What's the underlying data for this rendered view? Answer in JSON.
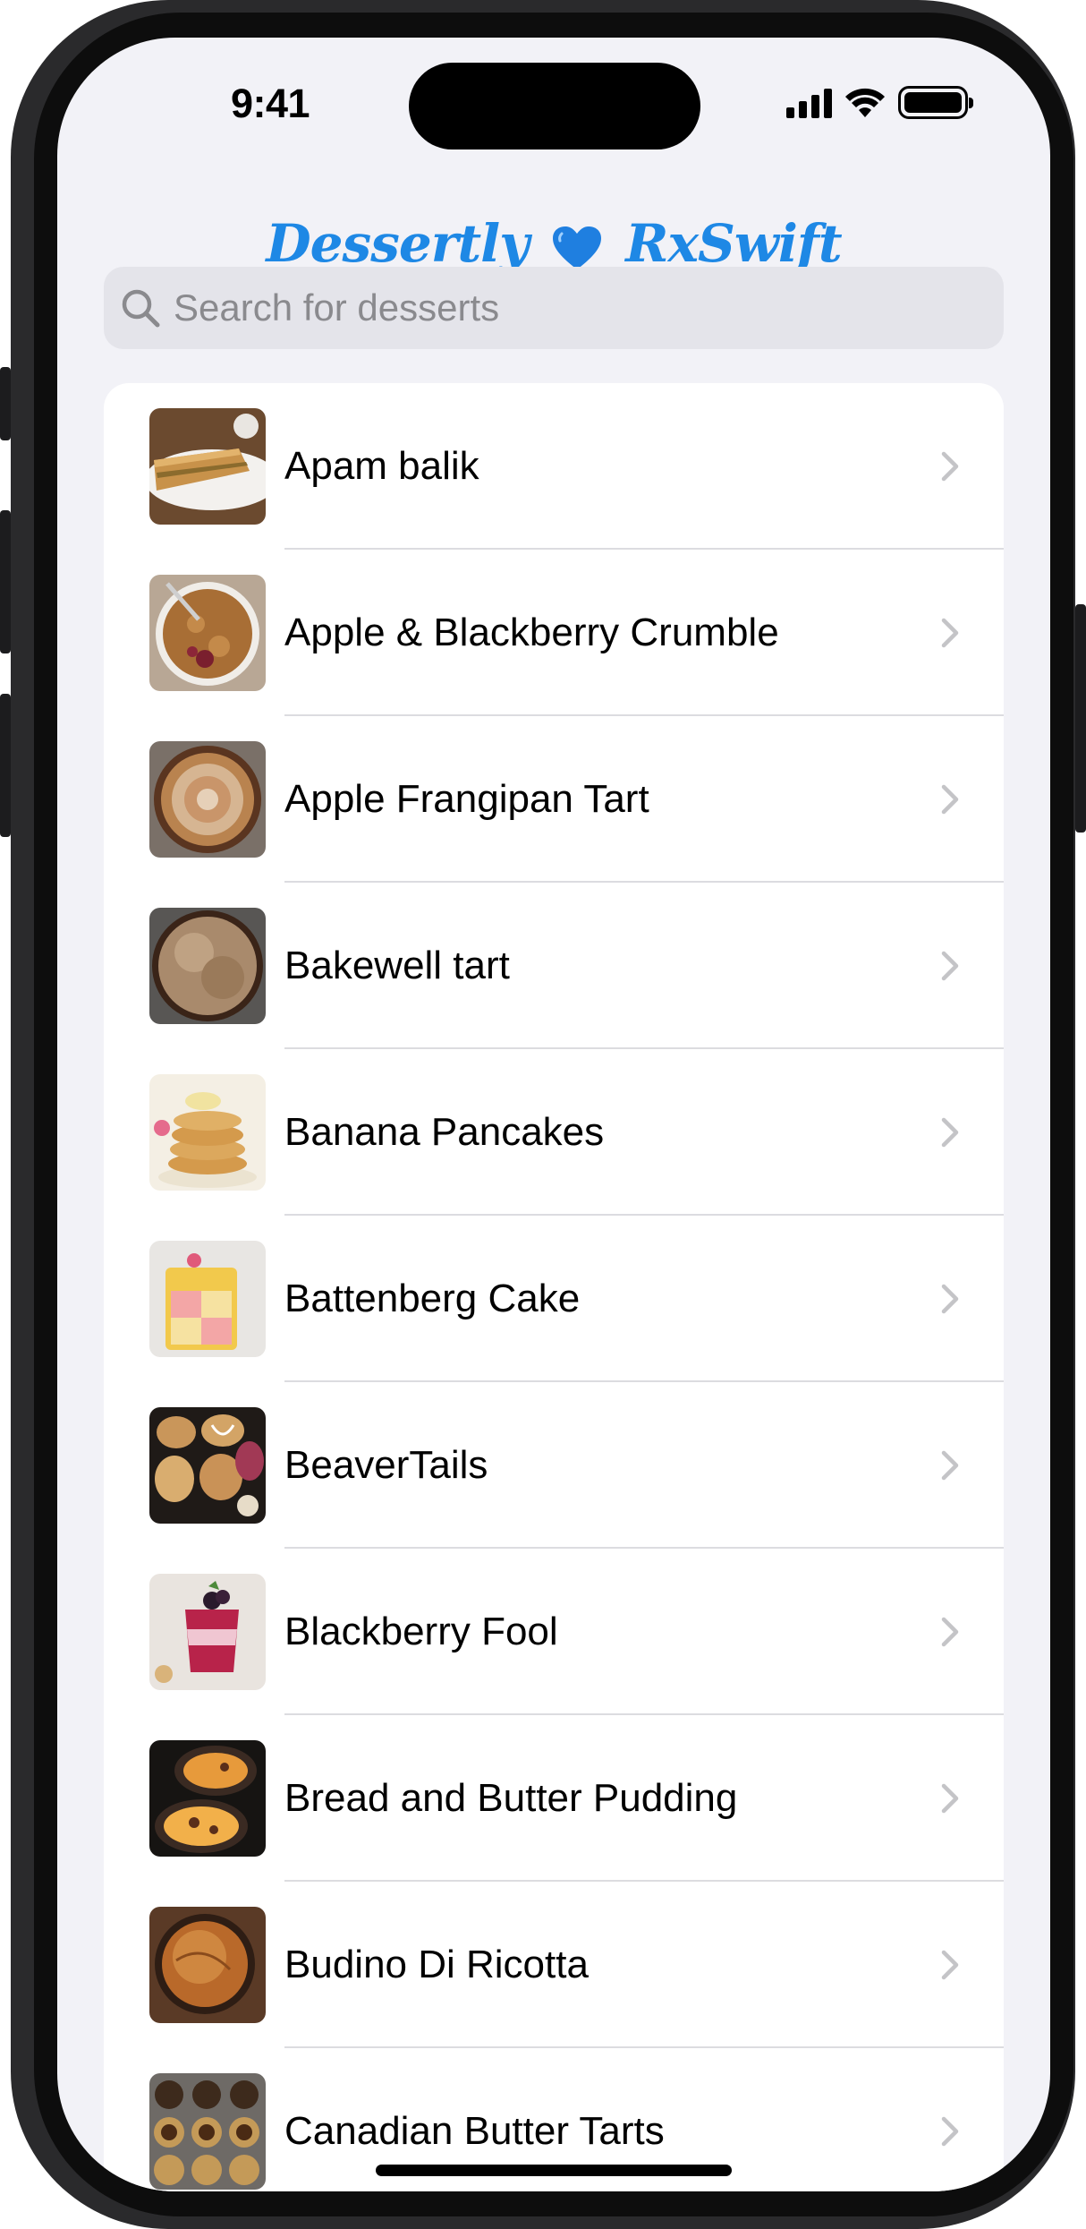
{
  "status_bar": {
    "time": "9:41"
  },
  "header": {
    "title_left": "Dessertly",
    "title_right": "RxSwift",
    "heart_icon": "blue-heart-icon"
  },
  "search": {
    "placeholder": "Search for desserts",
    "value": ""
  },
  "desserts": [
    {
      "name": "Apam balik"
    },
    {
      "name": "Apple & Blackberry Crumble"
    },
    {
      "name": "Apple Frangipan Tart"
    },
    {
      "name": "Bakewell tart"
    },
    {
      "name": "Banana Pancakes"
    },
    {
      "name": "Battenberg Cake"
    },
    {
      "name": "BeaverTails"
    },
    {
      "name": "Blackberry Fool"
    },
    {
      "name": "Bread and Butter Pudding"
    },
    {
      "name": "Budino Di Ricotta"
    },
    {
      "name": "Canadian Butter Tarts"
    }
  ],
  "colors": {
    "accent": "#1e88e5",
    "background": "#f2f2f7",
    "chevron": "#c4c4c7"
  }
}
